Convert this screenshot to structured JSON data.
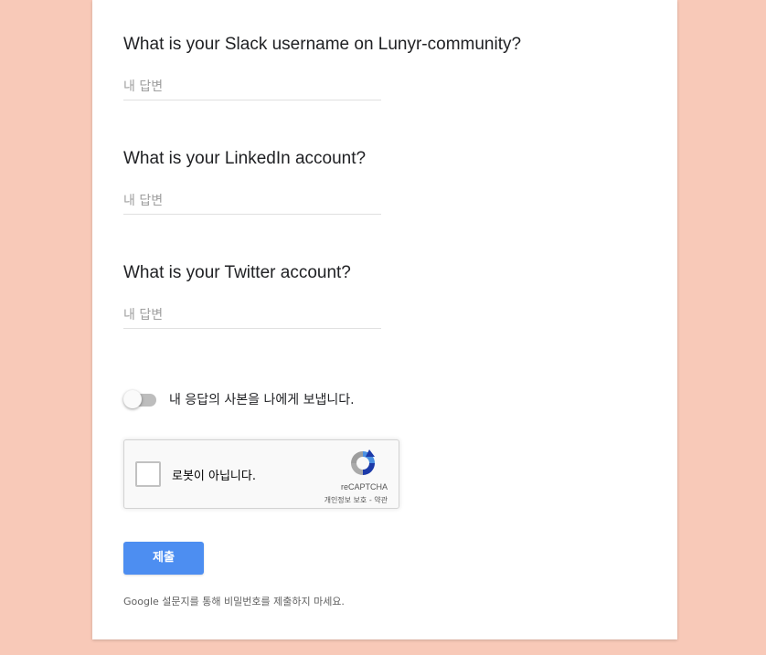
{
  "questions": [
    {
      "title": "What is your Slack username on Lunyr-community?",
      "placeholder": "내 답변"
    },
    {
      "title": "What is your LinkedIn account?",
      "placeholder": "내 답변"
    },
    {
      "title": "What is your Twitter account?",
      "placeholder": "내 답변"
    }
  ],
  "copy_toggle": {
    "label": "내 응답의 사본을 나에게 보냅니다.",
    "state": "off"
  },
  "recaptcha": {
    "label": "로봇이 아닙니다.",
    "brand": "reCAPTCHA",
    "privacy": "개인정보 보호",
    "separator": " - ",
    "terms": "약관",
    "logo_icon": "recaptcha-logo-icon"
  },
  "submit": {
    "label": "제출"
  },
  "footer": {
    "note": "Google 설문지를 통해 비밀번호를 제출하지 마세요."
  },
  "colors": {
    "background": "#f8c9b8",
    "card": "#ffffff",
    "submit": "#4d8ef1",
    "divider": "#e0e0e0"
  }
}
